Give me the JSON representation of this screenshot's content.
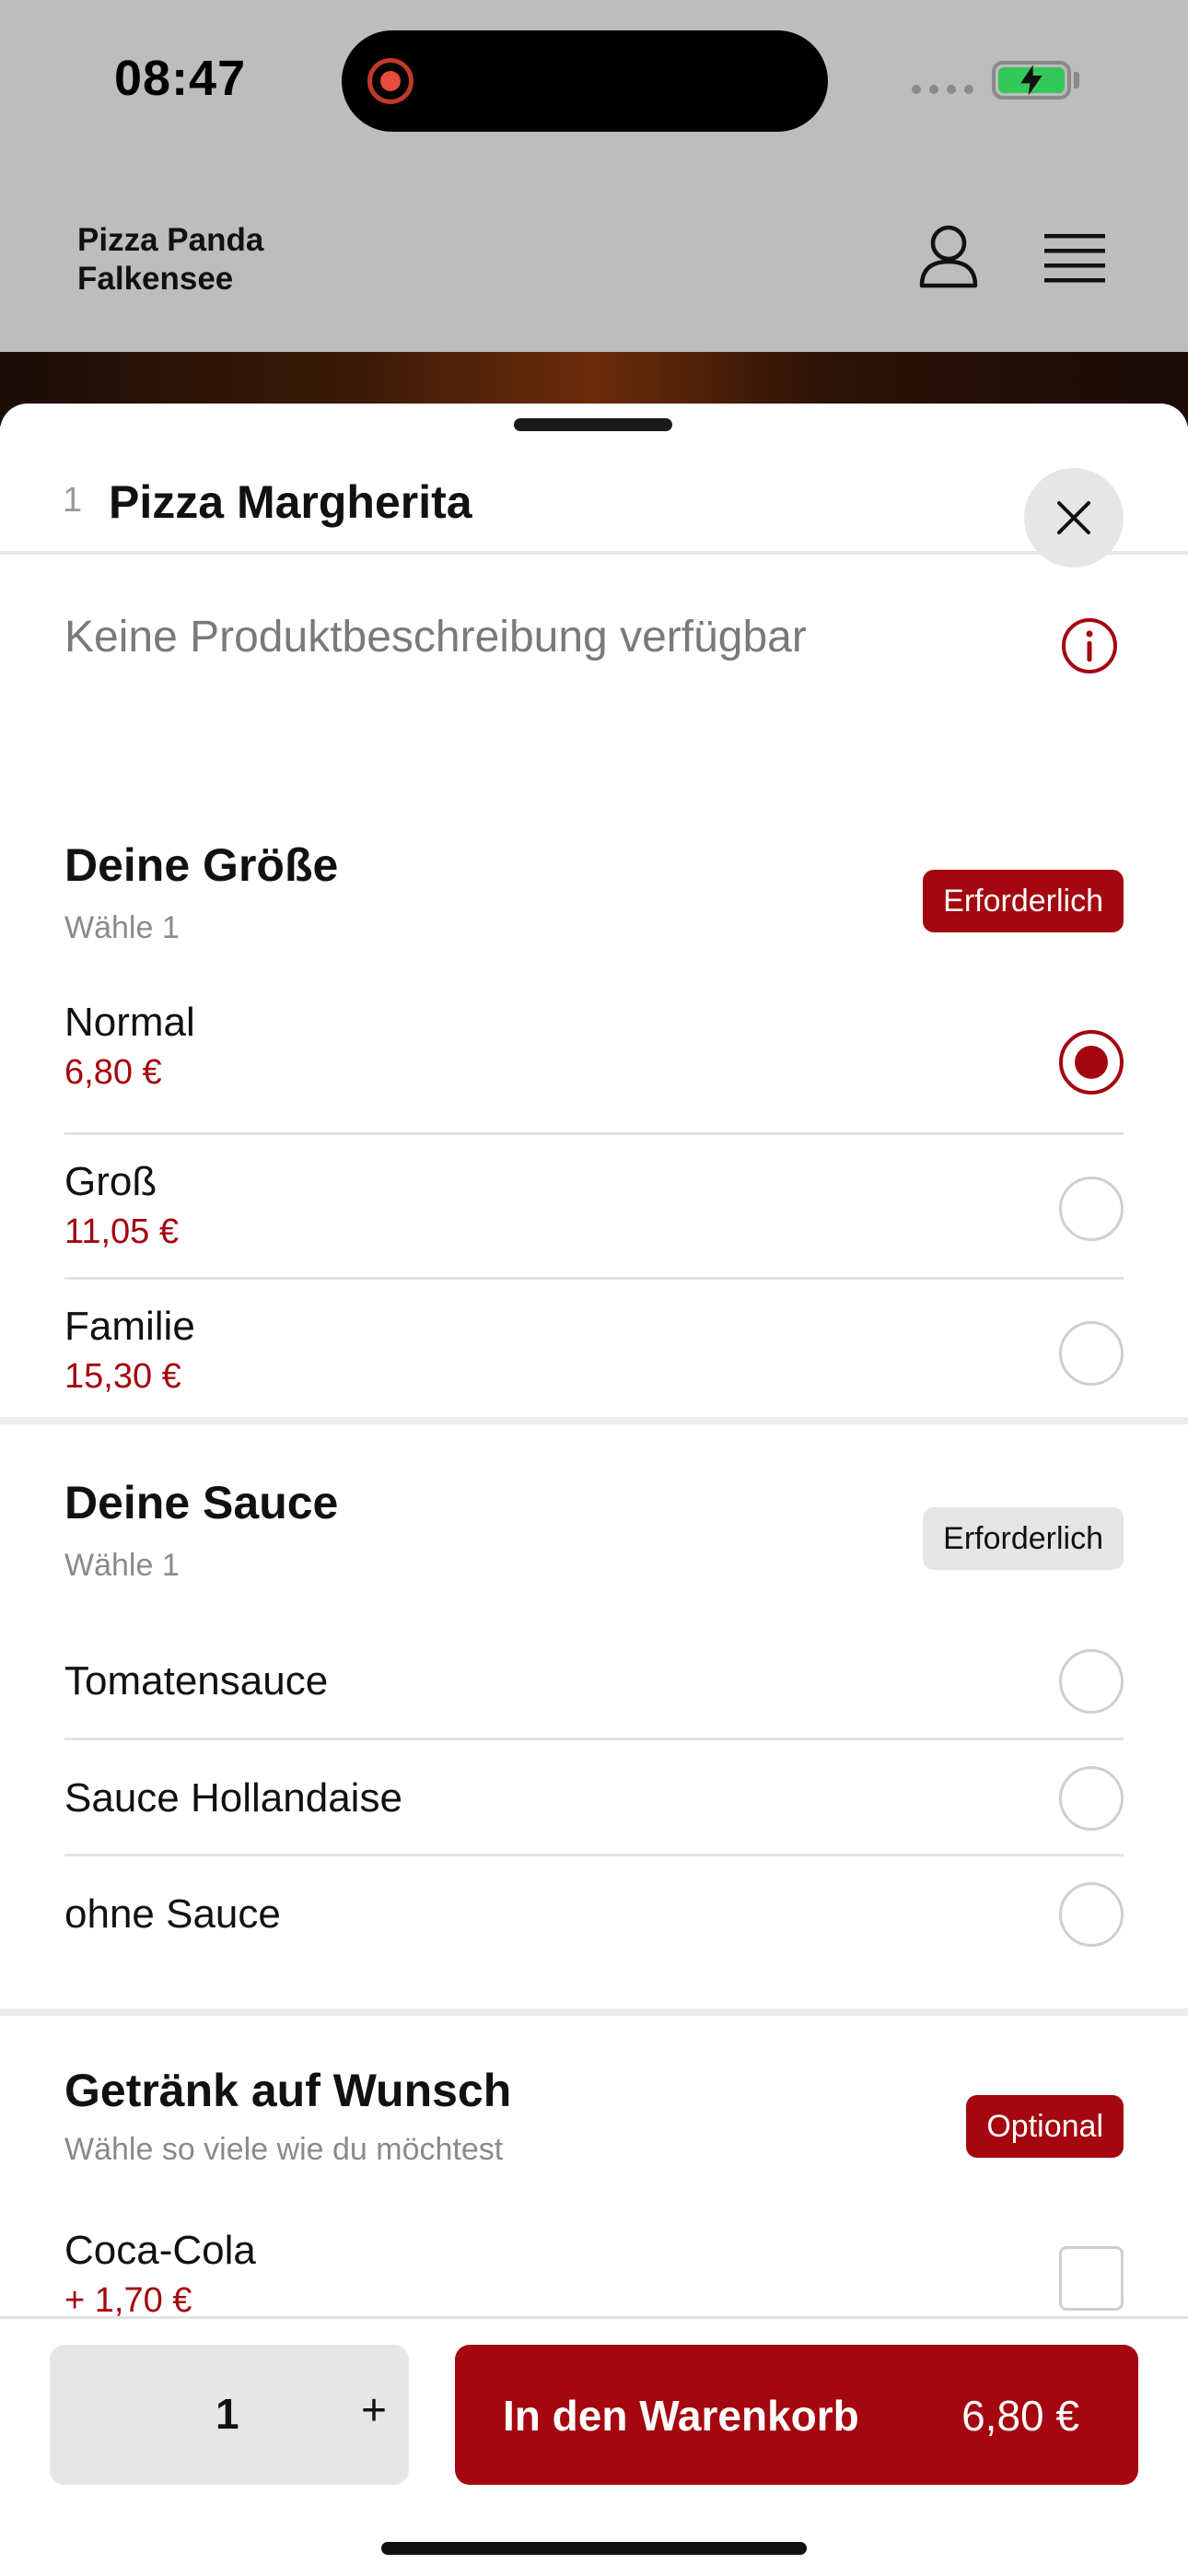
{
  "status_bar": {
    "time": "08:47"
  },
  "header": {
    "brand_line1": "Pizza Panda",
    "brand_line2": "Falkensee"
  },
  "product": {
    "number": "1",
    "title": "Pizza Margherita",
    "description": "Keine Produktbeschreibung verfügbar"
  },
  "groups": {
    "size": {
      "title": "Deine Größe",
      "subtitle": "Wähle 1",
      "badge": "Erforderlich",
      "options": [
        {
          "name": "Normal",
          "price": "6,80 €",
          "selected": true
        },
        {
          "name": "Groß",
          "price": "11,05 €",
          "selected": false
        },
        {
          "name": "Familie",
          "price": "15,30 €",
          "selected": false
        }
      ]
    },
    "sauce": {
      "title": "Deine Sauce",
      "subtitle": "Wähle 1",
      "badge": "Erforderlich",
      "options": [
        {
          "name": "Tomatensauce",
          "selected": false
        },
        {
          "name": "Sauce Hollandaise",
          "selected": false
        },
        {
          "name": "ohne Sauce",
          "selected": false
        }
      ]
    },
    "drinks": {
      "title": "Getränk auf Wunsch",
      "subtitle": "Wähle so viele wie du möchtest",
      "badge": "Optional",
      "options": [
        {
          "name": "Coca-Cola",
          "price": "+ 1,70 €",
          "checked": false
        }
      ]
    }
  },
  "bottom_bar": {
    "quantity": "1",
    "plus": "+",
    "cart_label": "In den Warenkorb",
    "cart_price": "6,80 €"
  },
  "colors": {
    "accent": "#a4070f",
    "header_bg": "#bdbdbd"
  }
}
